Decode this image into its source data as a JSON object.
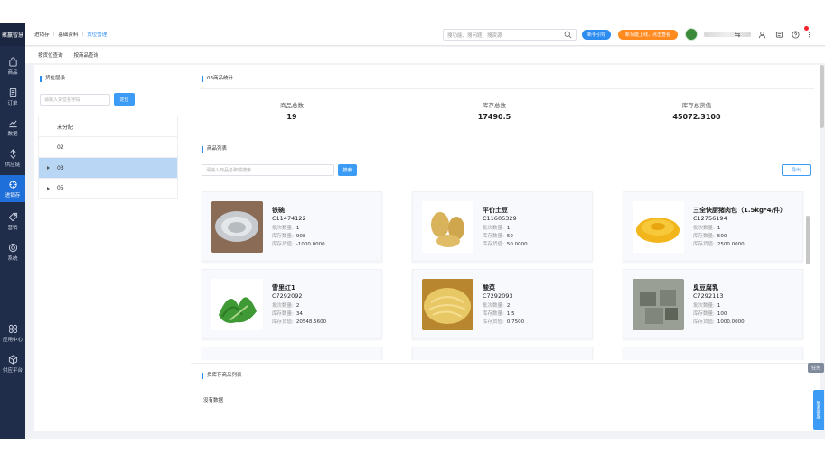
{
  "nav": {
    "brand": "聚赢智慧",
    "items": [
      "商品",
      "订单",
      "数据",
      "供应链",
      "进销存",
      "营销",
      "系统",
      "应用中心",
      "供应平台"
    ]
  },
  "header": {
    "breadcrumb": [
      "进销存",
      "基础资料",
      "货位管理"
    ],
    "search_placeholder": "搜功能、搜问题、搜资源",
    "guide_btn": "新手引导",
    "promo_btn": "新功能上线，点击查看",
    "switch_icon": "⇆"
  },
  "subtabs": [
    "按货位查询",
    "按商品查询"
  ],
  "left": {
    "title": "货位层级",
    "search_placeholder": "请输入货位名字段",
    "locate_btn": "定位",
    "tree": [
      {
        "label": "未分配"
      },
      {
        "label": "02"
      },
      {
        "label": "03"
      },
      {
        "label": "05"
      }
    ]
  },
  "stats": {
    "title": "03商品统计",
    "items": [
      {
        "label": "商品总数",
        "value": "19"
      },
      {
        "label": "库存总数",
        "value": "17490.5"
      },
      {
        "label": "库存总货值",
        "value": "45072.3100"
      }
    ]
  },
  "products": {
    "title": "商品列表",
    "search_placeholder": "请输入商品名称或搜索",
    "search_btn": "搜索",
    "export_btn": "导出",
    "labels": {
      "batches": "批次数量:",
      "stock": "库存数量:",
      "value": "库存货值:"
    },
    "items": [
      {
        "name": "铁碗",
        "code": "C11474122",
        "batches": "1",
        "stock": "908",
        "value": "-1000.0000"
      },
      {
        "name": "平价土豆",
        "code": "C11605329",
        "batches": "1",
        "stock": "50",
        "value": "50.0000"
      },
      {
        "name": "三全快厨猪肉包（1.5kg*4/件）",
        "code": "C12756194",
        "batches": "1",
        "stock": "500",
        "value": "2500.0000"
      },
      {
        "name": "雪里红1",
        "code": "C7292092",
        "batches": "2",
        "stock": "34",
        "value": "20548.5600"
      },
      {
        "name": "酸菜",
        "code": "C7292093",
        "batches": "2",
        "stock": "1.5",
        "value": "0.7500"
      },
      {
        "name": "臭豆腐乳",
        "code": "C7292113",
        "batches": "1",
        "stock": "100",
        "value": "1000.0000"
      }
    ]
  },
  "negative": {
    "title": "负库存商品列表",
    "empty": "没有数据"
  },
  "float": {
    "task": "任务",
    "side": "联系客服"
  },
  "colors": {
    "nav_bg": "#1f2d4a",
    "nav_active": "#1e6fd9",
    "accent": "#2d8cf0",
    "promo": "#ff8a1f",
    "selected_row": "#b9d7f5"
  }
}
